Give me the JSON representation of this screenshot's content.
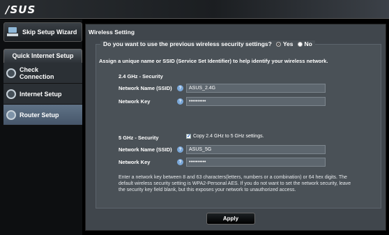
{
  "brand": {
    "logo": "/SUS"
  },
  "sidebar": {
    "wizard_label": "Skip Setup Wizard",
    "qis_title": "Quick Internet Setup",
    "items": [
      {
        "label": "Check Connection"
      },
      {
        "label": "Internet Setup"
      },
      {
        "label": "Router Setup"
      }
    ],
    "active_index": 2
  },
  "main": {
    "panel_title": "Wireless Setting",
    "question": "Do you want to use the previous wireless security settings?",
    "options": {
      "yes": "Yes",
      "no": "No",
      "selected": "yes"
    },
    "assign_text": "Assign a unique name or SSID (Service Set Identifier) to help identify your wireless network.",
    "band_24": {
      "section": "2.4 GHz - Security",
      "ssid_label": "Network Name (SSID)",
      "ssid_value": "ASUS_2.4G",
      "key_label": "Network Key",
      "key_value": "••••••••••"
    },
    "band_5": {
      "section": "5 GHz - Security",
      "copy_label": "Copy 2.4 GHz to 5 GHz settings.",
      "copy_checked": true,
      "ssid_label": "Network Name (SSID)",
      "ssid_value": "ASUS_5G",
      "key_label": "Network Key",
      "key_value": "••••••••••"
    },
    "note": "Enter a network key between 8 and 63 characters(letters, numbers or a combination) or 64 hex digits. The default wireless security setting is WPA2-Personal AES. If you do not want to set the network security, leave the security key field blank, but this exposes your network to unauthorized access.",
    "help_glyph": "?",
    "apply_label": "Apply"
  }
}
